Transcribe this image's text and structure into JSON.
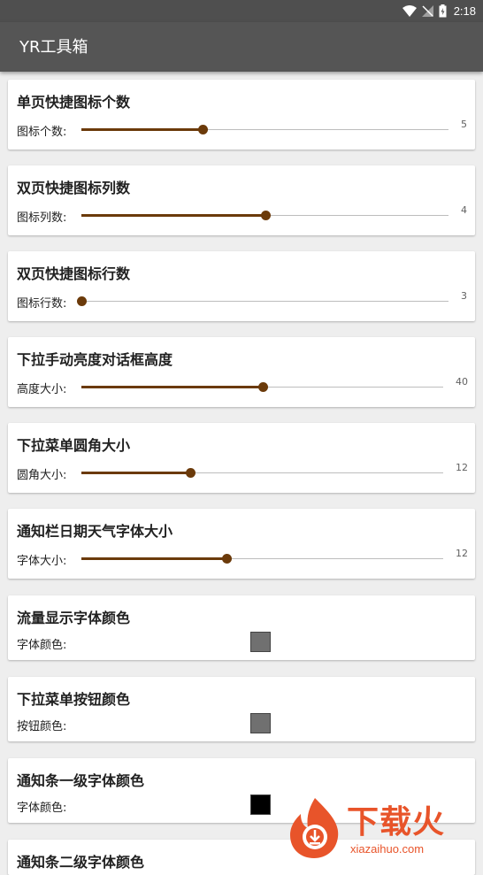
{
  "status_bar": {
    "time": "2:18",
    "icons": [
      "wifi-icon",
      "signal-off-icon",
      "battery-charging-icon"
    ]
  },
  "app_bar": {
    "title": "YR工具箱"
  },
  "colors": {
    "slider_accent": "#6b3a0a",
    "app_bar_bg": "#555555",
    "watermark": "#e8542a"
  },
  "settings": [
    {
      "title": "单页快捷图标个数",
      "label": "图标个数:",
      "value": "5",
      "fraction": 0.33
    },
    {
      "title": "双页快捷图标列数",
      "label": "图标列数:",
      "value": "4",
      "fraction": 0.5
    },
    {
      "title": "双页快捷图标行数",
      "label": "图标行数:",
      "value": "3",
      "fraction": 0.0
    },
    {
      "title": "下拉手动亮度对话框高度",
      "label": "高度大小:",
      "value": "40",
      "fraction": 0.5
    },
    {
      "title": "下拉菜单圆角大小",
      "label": "圆角大小:",
      "value": "12",
      "fraction": 0.3
    },
    {
      "title": "通知栏日期天气字体大小",
      "label": "字体大小:",
      "value": "12",
      "fraction": 0.4
    },
    {
      "title": "流量显示字体颜色",
      "label": "字体颜色:",
      "color": "#707070"
    },
    {
      "title": "下拉菜单按钮颜色",
      "label": "按钮颜色:",
      "color": "#707070"
    },
    {
      "title": "通知条一级字体颜色",
      "label": "字体颜色:",
      "color": "#000000"
    },
    {
      "title": "通知条二级字体颜色"
    }
  ],
  "watermark": {
    "text": "下载火",
    "url": "xiazaihuo.com"
  }
}
